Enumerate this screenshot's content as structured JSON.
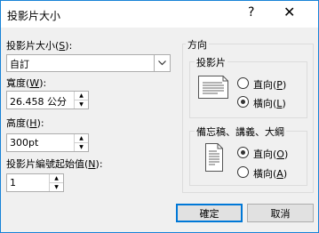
{
  "dialog": {
    "title": "投影片大小",
    "help": "?",
    "close": "✕"
  },
  "size": {
    "label": "投影片大小(",
    "label_key": "S",
    "label_end": "):",
    "selected": "自訂"
  },
  "width": {
    "label": "寬度(",
    "label_key": "W",
    "label_end": "):",
    "value": "26.458 公分"
  },
  "height": {
    "label": "高度(",
    "label_key": "H",
    "label_end": "):",
    "value": "300pt"
  },
  "start_number": {
    "label": "投影片編號起始值(",
    "label_key": "N",
    "label_end": "):",
    "value": "1"
  },
  "orientation": {
    "group_title": "方向",
    "slides": {
      "title": "投影片",
      "portrait": "直向(",
      "portrait_key": "P",
      "portrait_end": ")",
      "landscape": "橫向(",
      "landscape_key": "L",
      "landscape_end": ")",
      "selected": "landscape"
    },
    "notes": {
      "title": "備忘稿、講義、大綱",
      "portrait": "直向(",
      "portrait_key": "O",
      "portrait_end": ")",
      "landscape": "橫向(",
      "landscape_key": "A",
      "landscape_end": ")",
      "selected": "portrait"
    }
  },
  "buttons": {
    "ok": "確定",
    "cancel": "取消"
  }
}
